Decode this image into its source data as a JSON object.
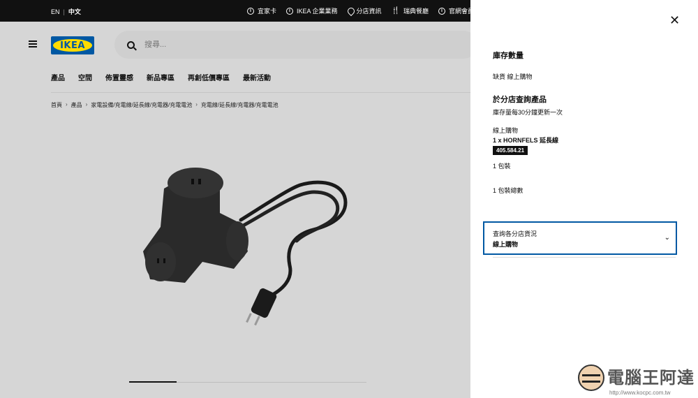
{
  "topbar": {
    "lang_en": "EN",
    "lang_zh": "中文",
    "links": [
      {
        "icon": "info-circle-icon",
        "label": "宜家卡"
      },
      {
        "icon": "info-circle-icon",
        "label": "IKEA 企業業務"
      },
      {
        "icon": "location-pin-icon",
        "label": "分店資訊"
      },
      {
        "icon": "fork-knife-icon",
        "label": "瑞典餐廳"
      },
      {
        "icon": "info-circle-icon",
        "label": "官網會員註"
      }
    ]
  },
  "header": {
    "logo_text": "IKEA",
    "search_placeholder": "搜尋..."
  },
  "nav": [
    "產品",
    "空間",
    "佈置靈感",
    "新品專區",
    "再創低價專區",
    "最新活動"
  ],
  "breadcrumb": [
    "首頁",
    "產品",
    "家電設備/充電線/延長線/充電器/充電電池",
    "充電線/延長線/充電器/充電電池"
  ],
  "panel": {
    "stock_title": "庫存數量",
    "stock_status": "缺貨 線上購物",
    "store_query_title": "於分店查詢產品",
    "update_note": "庫存量每30分鐘更新一次",
    "channel": "線上購物",
    "product_line": "1 x HORNFELS 延長線",
    "article_number": "405.584.21",
    "package": "1 包裝",
    "package_total": "1 包裝總數",
    "select_label": "查詢各分店貨況",
    "select_value": "線上購物"
  },
  "watermark": {
    "title": "電腦王阿達",
    "url": "http://www.kocpc.com.tw"
  },
  "colors": {
    "ikea_blue": "#0058a3",
    "ikea_yellow": "#ffdb00",
    "topbar": "#111111",
    "overlay_bg": "#d6d6d6"
  }
}
